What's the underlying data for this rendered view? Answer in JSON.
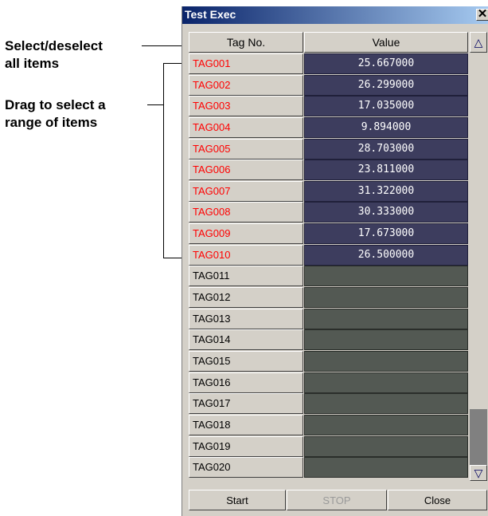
{
  "annotations": {
    "select_line1": "Select/deselect",
    "select_line2": "all items",
    "drag_line1": "Drag to select a",
    "drag_line2": "range of items"
  },
  "window": {
    "title": "Test Exec",
    "close_glyph": "✕"
  },
  "table": {
    "headers": {
      "tag": "Tag No.",
      "value": "Value"
    },
    "rows": [
      {
        "tag": "TAG001",
        "value": "25.667000"
      },
      {
        "tag": "TAG002",
        "value": "26.299000"
      },
      {
        "tag": "TAG003",
        "value": "17.035000"
      },
      {
        "tag": "TAG004",
        "value": "9.894000"
      },
      {
        "tag": "TAG005",
        "value": "28.703000"
      },
      {
        "tag": "TAG006",
        "value": "23.811000"
      },
      {
        "tag": "TAG007",
        "value": "31.322000"
      },
      {
        "tag": "TAG008",
        "value": "30.333000"
      },
      {
        "tag": "TAG009",
        "value": "17.673000"
      },
      {
        "tag": "TAG010",
        "value": "26.500000"
      },
      {
        "tag": "TAG011",
        "value": ""
      },
      {
        "tag": "TAG012",
        "value": ""
      },
      {
        "tag": "TAG013",
        "value": ""
      },
      {
        "tag": "TAG014",
        "value": ""
      },
      {
        "tag": "TAG015",
        "value": ""
      },
      {
        "tag": "TAG016",
        "value": ""
      },
      {
        "tag": "TAG017",
        "value": ""
      },
      {
        "tag": "TAG018",
        "value": ""
      },
      {
        "tag": "TAG019",
        "value": ""
      },
      {
        "tag": "TAG020",
        "value": ""
      }
    ]
  },
  "scrollbar": {
    "up_icon": "triangle-up-icon",
    "down_icon": "triangle-down-icon"
  },
  "buttons": {
    "start": "Start",
    "stop": "STOP",
    "close": "Close"
  },
  "colors": {
    "selected_text": "#ff0000",
    "selected_value_bg": "#3d3d5e",
    "empty_value_bg": "#535953"
  }
}
